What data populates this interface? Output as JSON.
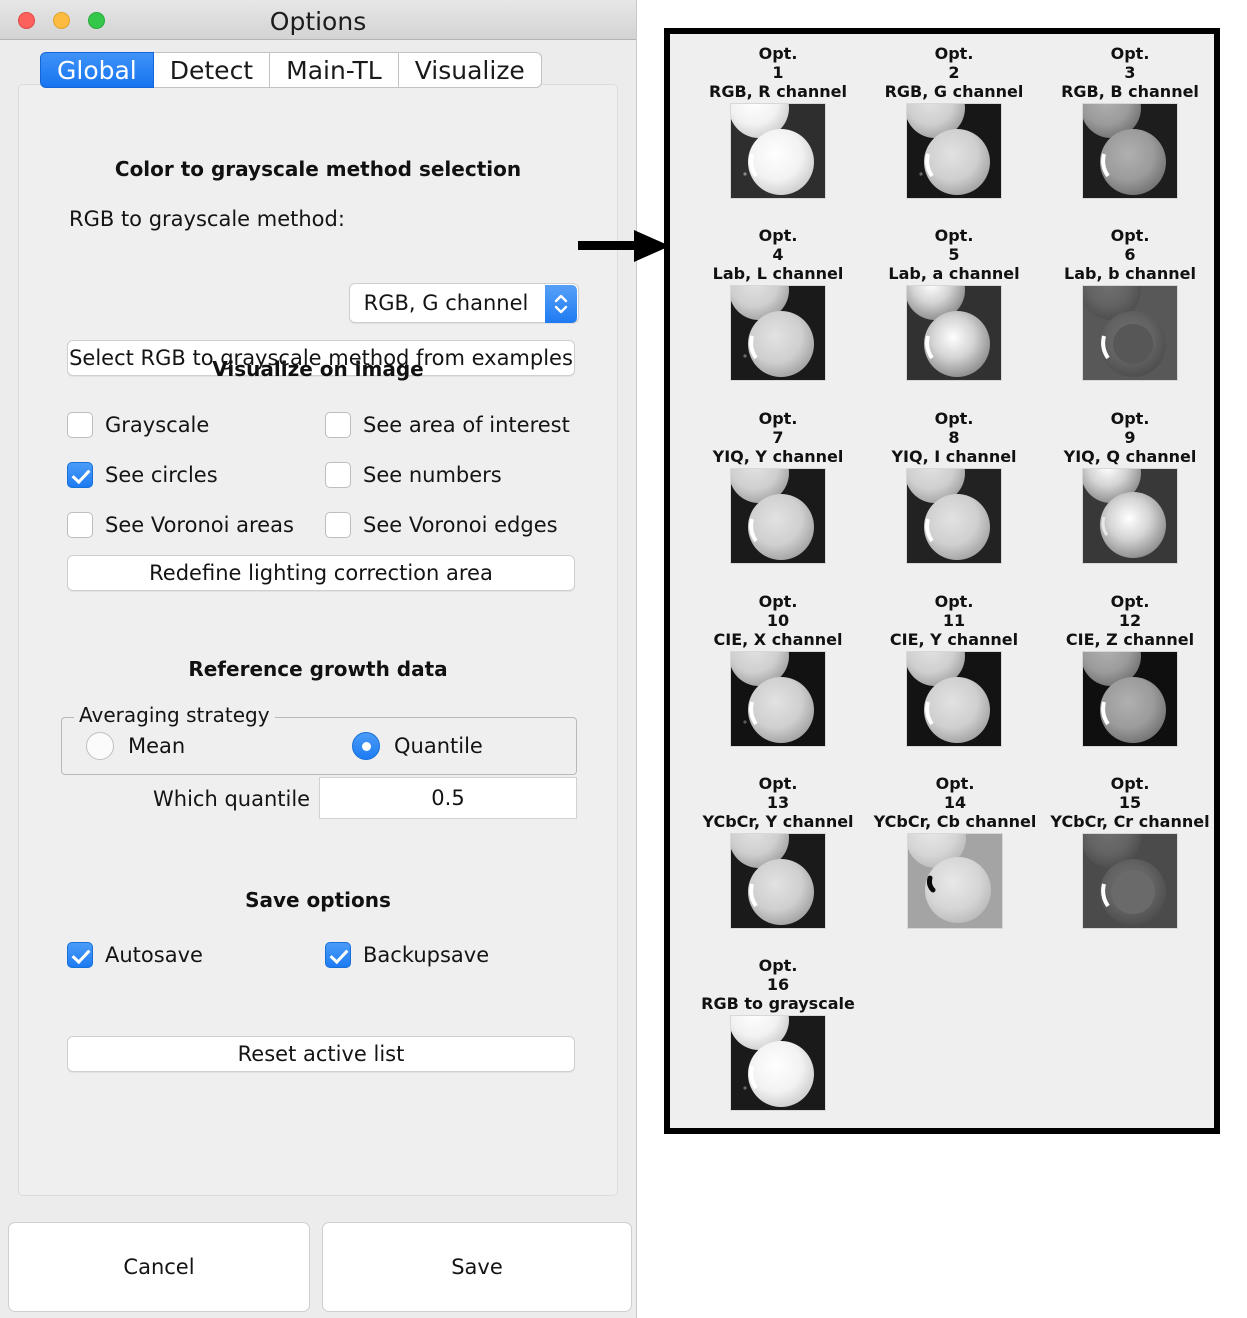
{
  "window": {
    "title": "Options",
    "traffic_lights": [
      "close-button",
      "minimize-button",
      "zoom-button"
    ]
  },
  "tabs": [
    {
      "label": "Global",
      "active": true
    },
    {
      "label": "Detect",
      "active": false
    },
    {
      "label": "Main-TL",
      "active": false
    },
    {
      "label": "Visualize",
      "active": false
    }
  ],
  "sections": {
    "color_method": {
      "heading": "Color to grayscale method selection",
      "field_label": "RGB to grayscale method:",
      "dropdown_value": "RGB, G channel",
      "examples_button": "Select RGB to grayscale method from examples"
    },
    "visualize": {
      "heading": "Visualize on image",
      "checkboxes": [
        {
          "label": "Grayscale",
          "checked": false
        },
        {
          "label": "See area of interest",
          "checked": false
        },
        {
          "label": "See circles",
          "checked": true
        },
        {
          "label": "See numbers",
          "checked": false
        },
        {
          "label": "See Voronoi areas",
          "checked": false
        },
        {
          "label": "See Voronoi edges",
          "checked": false
        }
      ],
      "redefine_button": "Redefine lighting correction area"
    },
    "reference": {
      "heading": "Reference growth data",
      "group_title": "Averaging strategy",
      "radios": [
        {
          "label": "Mean",
          "selected": false
        },
        {
          "label": "Quantile",
          "selected": true
        }
      ],
      "quantile_label": "Which quantile",
      "quantile_value": "0.5"
    },
    "save": {
      "heading": "Save options",
      "checkboxes": [
        {
          "label": "Autosave",
          "checked": true
        },
        {
          "label": "Backupsave",
          "checked": true
        }
      ],
      "reset_button": "Reset active list"
    }
  },
  "footer": {
    "cancel_label": "Cancel",
    "save_label": "Save"
  },
  "arrow": {
    "name": "right-arrow-connector",
    "color": "#000000"
  },
  "examples_panel": {
    "option_prefix": "Opt.",
    "options": [
      {
        "number": "1",
        "name": "RGB, R channel",
        "tone": "bright"
      },
      {
        "number": "2",
        "name": "RGB, G channel",
        "tone": "medium"
      },
      {
        "number": "3",
        "name": "RGB, B channel",
        "tone": "dim"
      },
      {
        "number": "4",
        "name": "Lab, L channel",
        "tone": "medium"
      },
      {
        "number": "5",
        "name": "Lab, a channel",
        "tone": "medium-soft"
      },
      {
        "number": "6",
        "name": "Lab, b channel",
        "tone": "flat-dark"
      },
      {
        "number": "7",
        "name": "YIQ, Y channel",
        "tone": "medium"
      },
      {
        "number": "8",
        "name": "YIQ, I channel",
        "tone": "medium"
      },
      {
        "number": "9",
        "name": "YIQ, Q channel",
        "tone": "noisy"
      },
      {
        "number": "10",
        "name": "CIE, X channel",
        "tone": "medium"
      },
      {
        "number": "11",
        "name": "CIE, Y channel",
        "tone": "medium"
      },
      {
        "number": "12",
        "name": "CIE, Z channel",
        "tone": "dim"
      },
      {
        "number": "13",
        "name": "YCbCr, Y channel",
        "tone": "medium"
      },
      {
        "number": "14",
        "name": "YCbCr, Cb channel",
        "tone": "inverted"
      },
      {
        "number": "15",
        "name": "YCbCr, Cr channel",
        "tone": "flat-dark"
      },
      {
        "number": "16",
        "name": "RGB to grayscale",
        "tone": "medium"
      }
    ]
  },
  "colors": {
    "accent": "#1d7bf2",
    "window_bg": "#ececec",
    "panel_bg": "#efefef",
    "panel_border": "#000000"
  }
}
